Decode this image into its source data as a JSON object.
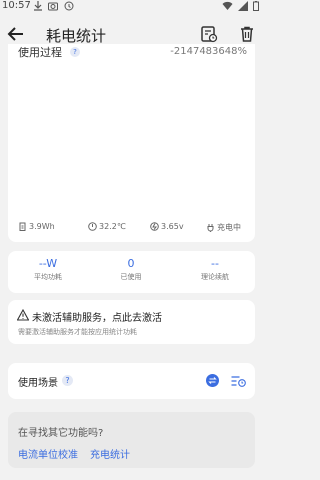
{
  "status_bar": {
    "time": "10:57"
  },
  "app_bar": {
    "title": "耗电统计"
  },
  "chart": {
    "title": "使用过程",
    "help": "?",
    "top_value": "-2147483648%"
  },
  "battery_stats": {
    "capacity": "3.9Wh",
    "temperature": "32.2℃",
    "voltage": "3.65v",
    "charging": "充电中"
  },
  "summary": [
    {
      "value": "--W",
      "label": "平均功耗"
    },
    {
      "value": "0",
      "label": "已使用"
    },
    {
      "value": "--",
      "label": "理论续航"
    }
  ],
  "notice": {
    "title": "未激活辅助服务，点此去激活",
    "subtitle": "需要激活辅助服务才能按应用统计功耗"
  },
  "scene": {
    "title": "使用场景",
    "help": "?"
  },
  "more": {
    "title": "在寻找其它功能吗?",
    "links": [
      "电流单位校准",
      "充电统计"
    ]
  },
  "colors": {
    "accent": "#3b6de0",
    "background": "#f2f2f2",
    "card": "#ffffff"
  },
  "icons": [
    "download-icon",
    "camera-icon",
    "clock-icon",
    "wifi-icon",
    "signal-icon",
    "battery-icon",
    "back-arrow-icon",
    "history-icon",
    "trash-icon",
    "battery-capacity-icon",
    "temperature-icon",
    "voltage-icon",
    "plug-icon",
    "warning-icon",
    "swap-icon",
    "timer-list-icon"
  ]
}
